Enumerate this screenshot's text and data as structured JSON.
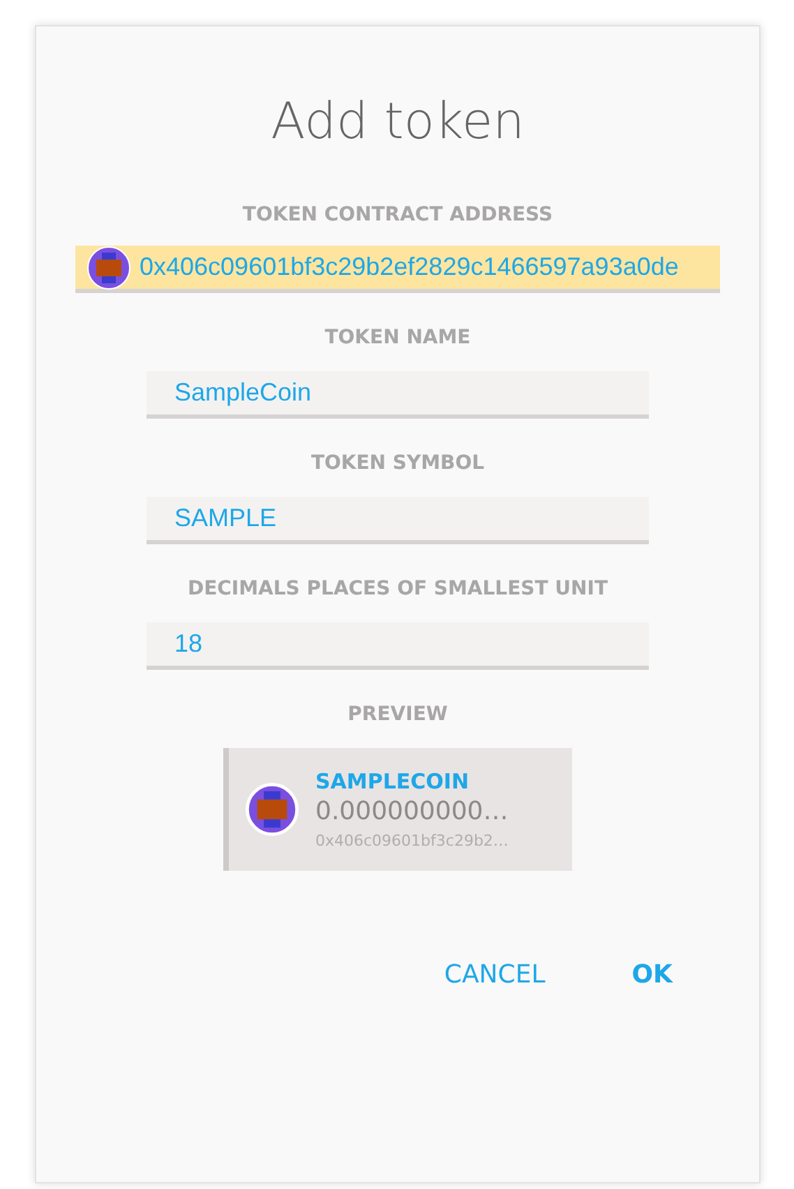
{
  "dialog": {
    "title": "Add token"
  },
  "fields": [
    {
      "kind": "address",
      "label": "TOKEN CONTRACT ADDRESS",
      "value": "0x406c09601bf3c29b2ef2829c1466597a93a0de",
      "highlighted": true
    },
    {
      "kind": "text",
      "label": "TOKEN NAME",
      "value": "SampleCoin",
      "highlighted": false
    },
    {
      "kind": "text",
      "label": "TOKEN SYMBOL",
      "value": "SAMPLE",
      "highlighted": false
    },
    {
      "kind": "text",
      "label": "DECIMALS PLACES OF SMALLEST UNIT",
      "value": "18",
      "highlighted": false
    }
  ],
  "preview": {
    "label": "PREVIEW",
    "name": "SAMPLECOIN",
    "balance": "0.000000000…",
    "address": "0x406c09601bf3c29b2…"
  },
  "buttons": [
    {
      "label": "CANCEL",
      "primary": false
    },
    {
      "label": "OK",
      "primary": true
    }
  ]
}
